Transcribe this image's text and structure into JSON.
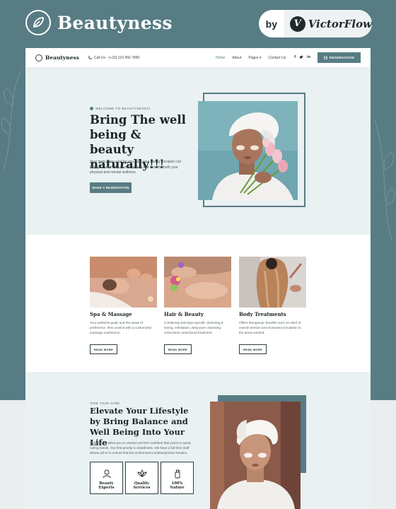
{
  "brand": {
    "name": "Beautyness",
    "by": "by",
    "partner": "VictorFlow",
    "partner_initial": "V"
  },
  "nav": {
    "brand": "Beautyness",
    "call": "Call Us - (+22) 123 456 7890",
    "links": [
      "Home",
      "About",
      "Pages",
      "Contact Us"
    ],
    "social": [
      "f",
      "t",
      "in"
    ],
    "reservation": "RESERVATION"
  },
  "hero": {
    "eyebrow": "WELCOME TO BEAUTYNESS!!!",
    "title": "Bring The well being & beauty naturally!!!",
    "text": "Your body does a lot for you, and your caring therapist can help you return the favor in a way that benefits both your physical and mental wellness.",
    "button": "MAKE A RESERVATION"
  },
  "services": [
    {
      "title": "Spa & Massage",
      "text": "Your wellness goals and the areas of preference, then unwind with a customized massage experience.",
      "button": "READ MORE"
    },
    {
      "title": "Hair & Beauty",
      "text": "Combining skin-type-specific cleansing & toning, exfoliation, deep-pore cleansing extractions customized treatment.",
      "button": "READ MORE"
    },
    {
      "title": "Body Treatments",
      "text": "Offers therapeutic benefits such as relief of muscle tension and increased circulation to the areas worked.",
      "button": "READ MORE"
    }
  ],
  "care": {
    "eyebrow": "TAKE YOUR CARE",
    "title": "Elevate Your Lifestyle by Bring Balance and Well Being Into Your Life",
    "text": "Designed to allow you to unwind and feel confident that you're in good, caring hands. Our first priority is cleanliness. We have a full-time staff whose job is to ensure that the environment at Beautyness remains.",
    "features": [
      {
        "l1": "Beauty",
        "l2": "Experts",
        "icon": "expert-icon"
      },
      {
        "l1": "Quality",
        "l2": "Services",
        "icon": "lotus-icon"
      },
      {
        "l1": "100%",
        "l2": "Nature",
        "icon": "bottle-icon"
      }
    ]
  },
  "colors": {
    "accent": "#587c84",
    "hero_bg": "#e9f1f2",
    "text_dark": "#1b2426"
  }
}
